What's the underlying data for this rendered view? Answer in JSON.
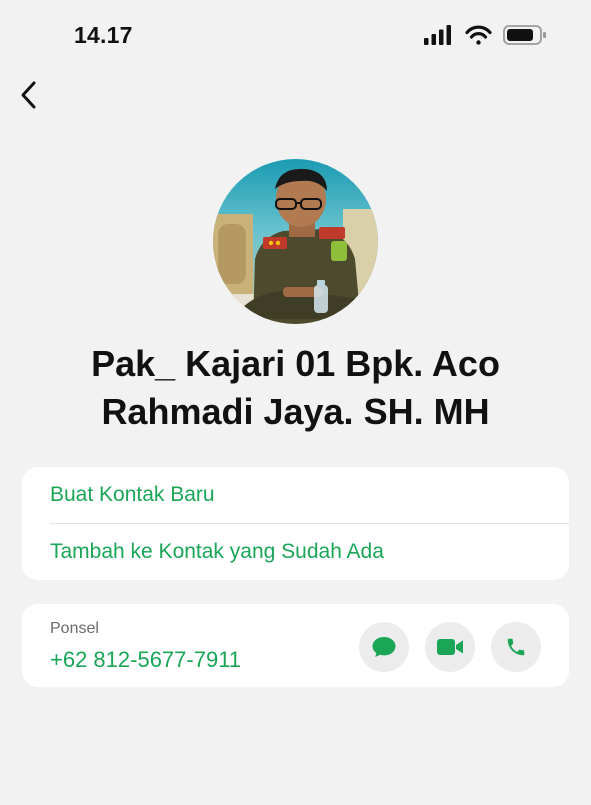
{
  "status_bar": {
    "time": "14.17",
    "icons": [
      "cellular-signal-icon",
      "wifi-icon",
      "battery-icon"
    ]
  },
  "nav": {
    "back_icon": "chevron-left-icon"
  },
  "contact": {
    "avatar": "profile-photo",
    "name": "Pak_ Kajari 01 Bpk. Aco Rahmadi Jaya. SH. MH"
  },
  "actions": {
    "create_new": "Buat Kontak Baru",
    "add_existing": "Tambah ke Kontak yang Sudah Ada"
  },
  "phone": {
    "label": "Ponsel",
    "number": "+62 812-5677-7911",
    "buttons": [
      "message-icon",
      "video-call-icon",
      "phone-call-icon"
    ]
  },
  "colors": {
    "accent": "#1aa557",
    "background": "#f2f2f2",
    "card": "#ffffff",
    "icon_button_bg": "#ececec"
  }
}
